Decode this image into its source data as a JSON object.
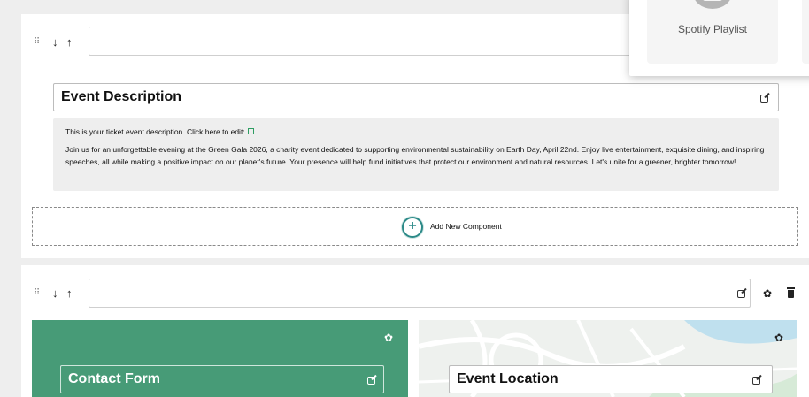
{
  "section1": {
    "move_down": "↓",
    "move_up": "↑",
    "drag_handle": "⠿",
    "description_component": {
      "title": "Event Description",
      "intro": "This is your ticket event description. Click here to edit:",
      "body": "Join us for an unforgettable evening at the Green Gala 2026, a charity event dedicated to supporting environmental sustainability on Earth Day, April 22nd. Enjoy live entertainment, exquisite dining, and inspiring speeches, all while making a positive impact on our planet's future. Your presence will help fund initiatives that protect our environment and natural resources. Let's unite for a greener, brighter tomorrow!"
    },
    "add_component": {
      "plus": "+",
      "label": "Add New Component"
    }
  },
  "section2": {
    "move_down": "↓",
    "move_up": "↑",
    "drag_handle": "⠿",
    "contact_form": {
      "title": "Contact Form"
    },
    "event_location": {
      "title": "Event Location"
    }
  },
  "popup": {
    "spotify_label": "Spotify Playlist"
  },
  "icons": {
    "gear": "✿"
  },
  "colors": {
    "accent": "#2c8a88",
    "green_panel": "#479b77"
  }
}
